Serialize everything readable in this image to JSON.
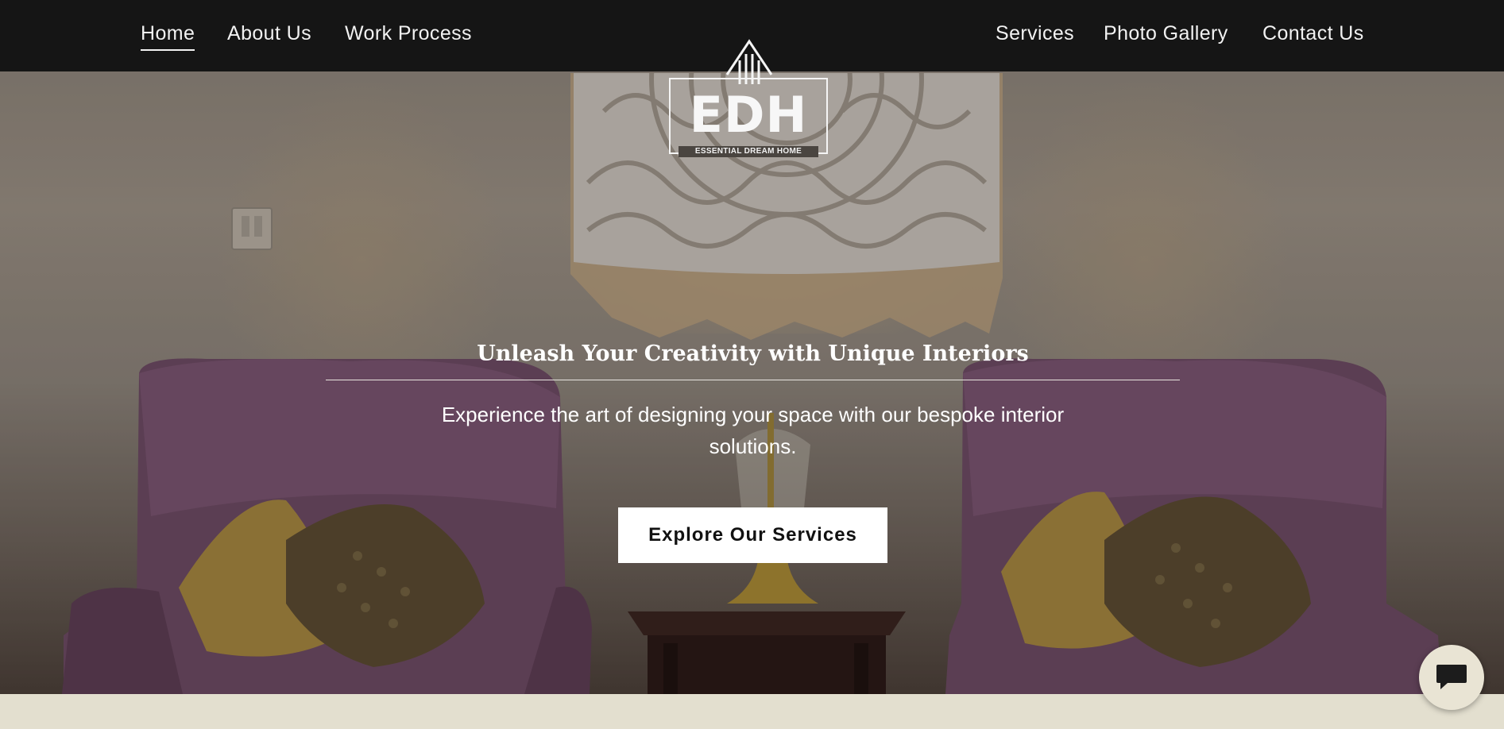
{
  "nav": {
    "left": [
      {
        "label": "Home",
        "active": true
      },
      {
        "label": "About Us"
      },
      {
        "label": "Work Process"
      }
    ],
    "right": [
      {
        "label": "Services"
      },
      {
        "label": "Photo Gallery"
      },
      {
        "label": "Contact Us"
      }
    ]
  },
  "logo": {
    "mark": "EDH",
    "tagline": "ESSENTIAL DREAM HOME",
    "icon": "house-lines-icon"
  },
  "hero": {
    "title": "Unleash Your Creativity with Unique Interiors",
    "subtitle": "Experience the art of designing your space with our bespoke interior solutions.",
    "cta_label": "Explore Our Services"
  },
  "chat": {
    "icon": "chat-bubble-icon"
  },
  "colors": {
    "navbar": "#151515",
    "nav_text": "#f2f2f2",
    "hero_text": "#ffffff",
    "cta_bg": "#ffffff",
    "footer_band": "#e3dfcf",
    "chat_bg": "#e9e4d4"
  }
}
